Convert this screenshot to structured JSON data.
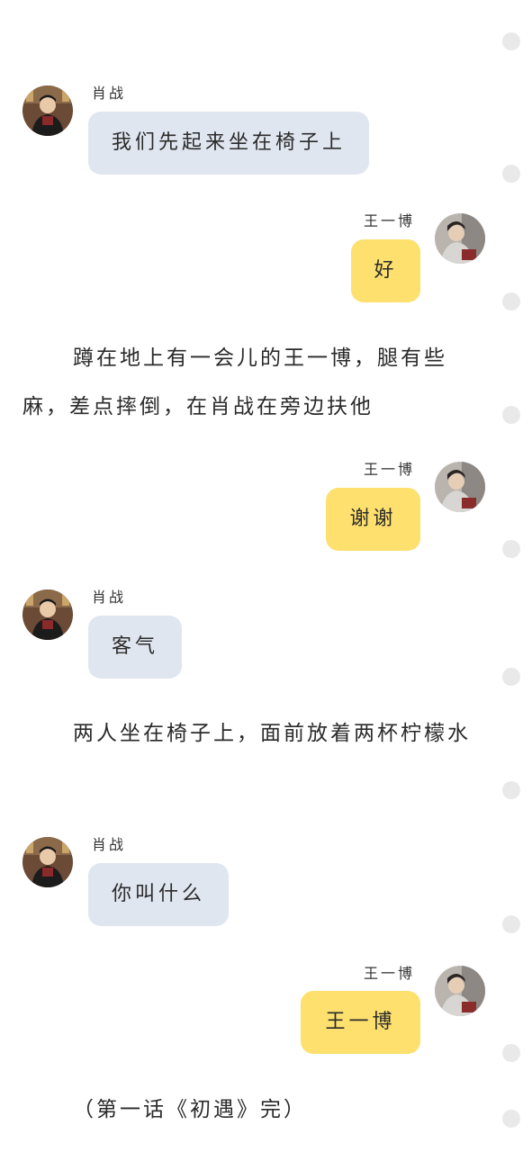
{
  "top_cut_text": "…",
  "narrations": [
    "蹲在地上有一会儿的王一博，腿有些麻，差点摔倒，在肖战在旁边扶他",
    "两人坐在椅子上，面前放着两杯柠檬水",
    "（第一话《初遇》完）"
  ],
  "messages": [
    {
      "speaker": "肖战",
      "text": "我们先起来坐在椅子上",
      "side": "left",
      "avatar": "xiao-zhan-avatar"
    },
    {
      "speaker": "王一博",
      "text": "好",
      "side": "right",
      "avatar": "wang-yibo-avatar"
    },
    {
      "speaker": "王一博",
      "text": "谢谢",
      "side": "right",
      "avatar": "wang-yibo-avatar"
    },
    {
      "speaker": "肖战",
      "text": "客气",
      "side": "left",
      "avatar": "xiao-zhan-avatar"
    },
    {
      "speaker": "肖战",
      "text": "你叫什么",
      "side": "left",
      "avatar": "xiao-zhan-avatar"
    },
    {
      "speaker": "王一博",
      "text": "王一博",
      "side": "right",
      "avatar": "wang-yibo-avatar"
    }
  ],
  "colors": {
    "left_bubble": "#e0e6ef",
    "right_bubble": "#fde06e",
    "side_dot": "#e9e9e9",
    "text": "#2a2a2a"
  }
}
